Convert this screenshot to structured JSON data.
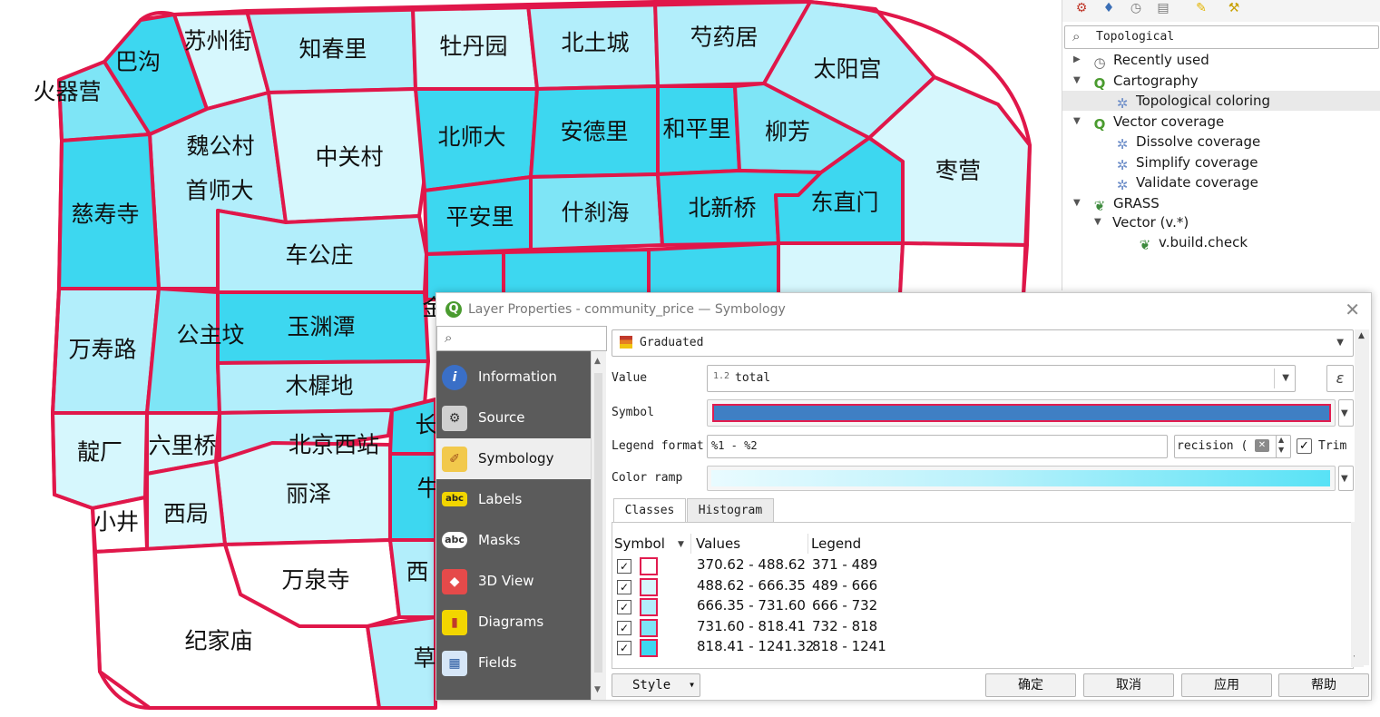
{
  "map": {
    "districts": [
      "火器营",
      "巴沟",
      "苏州街",
      "知春里",
      "牡丹园",
      "北土城",
      "芍药居",
      "太阳宫",
      "魏公村",
      "首师大",
      "中关村",
      "北师大",
      "安德里",
      "和平里",
      "柳芳",
      "枣营",
      "慈寿寺",
      "平安里",
      "什刹海",
      "北新桥",
      "东直门",
      "车公庄",
      "万寿路",
      "公主坟",
      "玉渊潭",
      "木樨地",
      "北京西站",
      "靛厂",
      "六里桥",
      "丽泽",
      "小井",
      "西局",
      "万泉寺",
      "纪家庙",
      "长",
      "牛",
      "西",
      "草",
      "金"
    ],
    "colors": {
      "boundary": "#e0174a",
      "c1": "#ffffff",
      "c2": "#d6f7fd",
      "c3": "#b2eefb",
      "c4": "#7ee5f6",
      "c5": "#3dd7f0"
    }
  },
  "toolbox": {
    "search_value": "Topological",
    "nodes": {
      "recent": "Recently used",
      "cartography": "Cartography",
      "topo_color": "Topological coloring",
      "vector_cov": "Vector coverage",
      "dissolve": "Dissolve coverage",
      "simplify": "Simplify coverage",
      "validate": "Validate coverage",
      "grass": "GRASS",
      "vector_v": "Vector (v.*)",
      "build_check": "v.build.check"
    }
  },
  "dialog": {
    "title": "Layer Properties - community_price — Symbology",
    "nav": {
      "information": "Information",
      "source": "Source",
      "symbology": "Symbology",
      "labels": "Labels",
      "masks": "Masks",
      "view3d": "3D View",
      "diagrams": "Diagrams",
      "fields": "Fields"
    },
    "renderer": "Graduated",
    "value_label": "Value",
    "value_type": "1.2",
    "value_field": "total",
    "symbol_label": "Symbol",
    "legend_format_label": "Legend format",
    "legend_format": "%1 - %2",
    "precision": "recision (",
    "trim_label": "Trim",
    "color_ramp_label": "Color ramp",
    "tabs": {
      "classes": "Classes",
      "histogram": "Histogram"
    },
    "table_headers": {
      "symbol": "Symbol",
      "values": "Values",
      "legend": "Legend"
    },
    "classes": [
      {
        "values": "370.62 - 488.62",
        "legend": "371 - 489",
        "color": "#ffffff"
      },
      {
        "values": "488.62 - 666.35",
        "legend": "489 - 666",
        "color": "#d6f7fd"
      },
      {
        "values": "666.35 - 731.60",
        "legend": "666 - 732",
        "color": "#b2eefb"
      },
      {
        "values": "731.60 - 818.41",
        "legend": "732 - 818",
        "color": "#7ee5f6"
      },
      {
        "values": "818.41 - 1241.32",
        "legend": "818 - 1241",
        "color": "#3dd7f0"
      }
    ],
    "buttons": {
      "style": "Style",
      "ok": "确定",
      "cancel": "取消",
      "apply": "应用",
      "help": "帮助"
    }
  }
}
